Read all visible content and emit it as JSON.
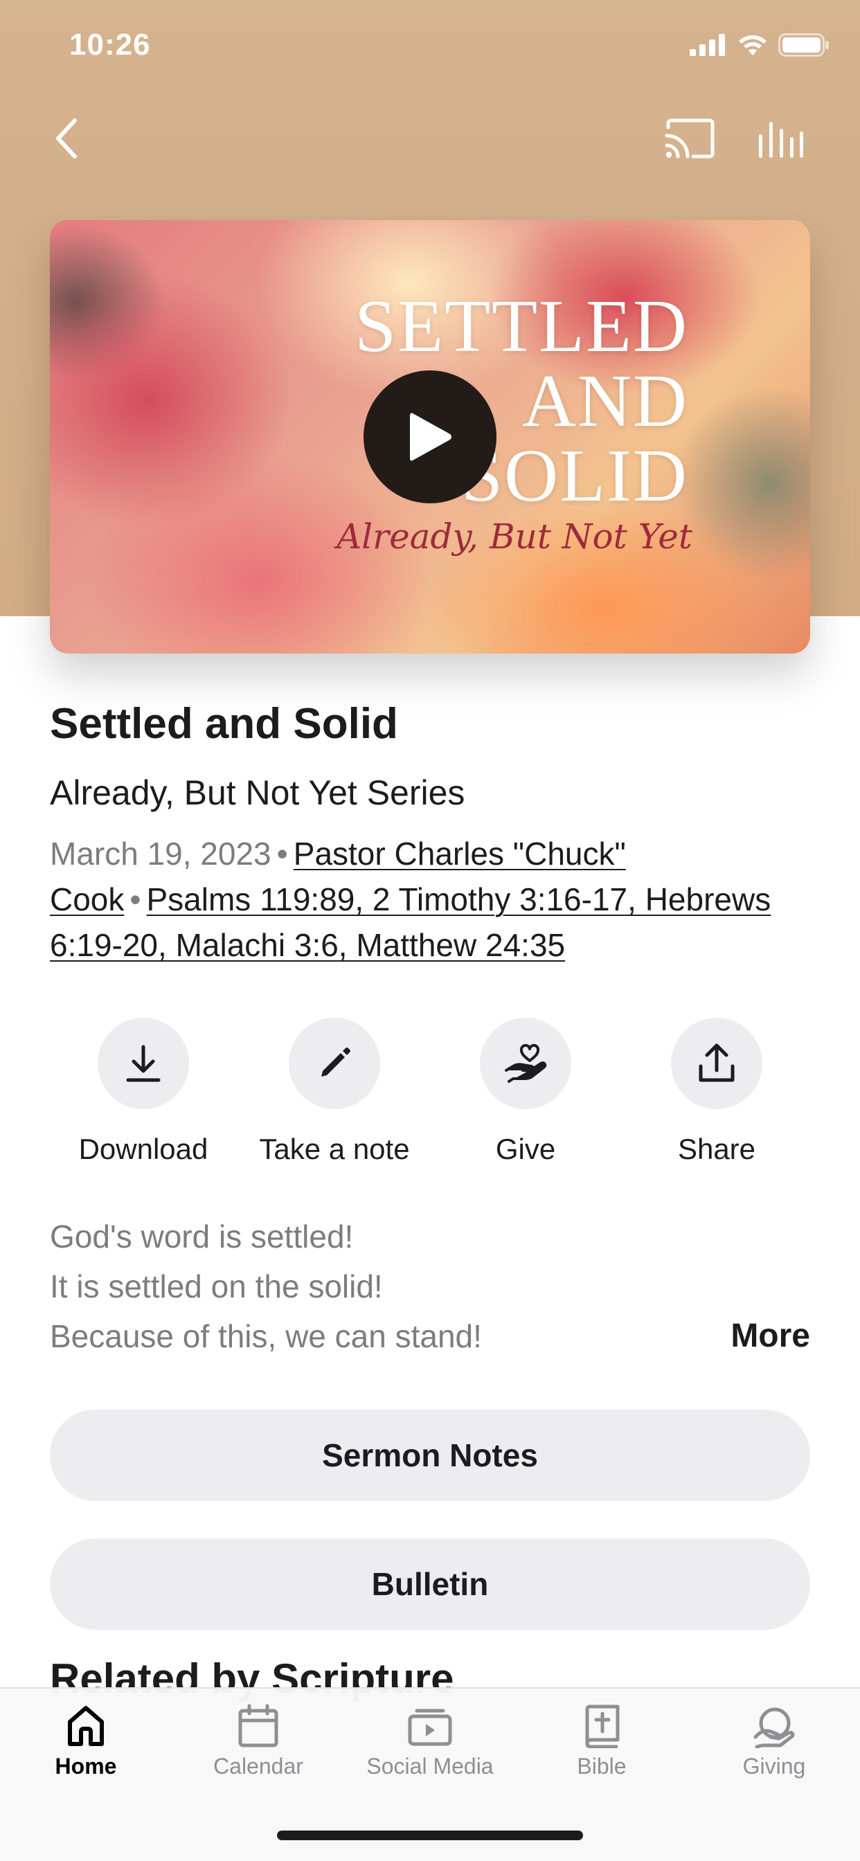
{
  "status_bar": {
    "time": "10:26"
  },
  "artwork": {
    "title_lines": [
      "SETTLED",
      "AND",
      "SOLID"
    ],
    "subtitle": "Already, But Not Yet"
  },
  "sermon": {
    "title": "Settled and Solid",
    "series": "Already, But Not Yet Series",
    "date": "March 19, 2023",
    "separator": "•",
    "speaker": "Pastor Charles \"Chuck\" Cook",
    "scripture": "Psalms 119:89, 2 Timothy 3:16-17, Hebrews 6:19-20, Malachi 3:6, Matthew 24:35"
  },
  "actions": [
    {
      "label": "Download",
      "icon": "download-icon"
    },
    {
      "label": "Take a note",
      "icon": "pencil-icon"
    },
    {
      "label": "Give",
      "icon": "heart-hand-icon"
    },
    {
      "label": "Share",
      "icon": "share-icon"
    }
  ],
  "description": {
    "lines": [
      "God's word is settled!",
      "It is settled on the solid!",
      "Because of this, we can stand!"
    ],
    "more_label": "More"
  },
  "buttons": {
    "sermon_notes": "Sermon Notes",
    "bulletin": "Bulletin"
  },
  "related_heading": "Related by Scripture",
  "tab_bar": {
    "active": "Home",
    "tabs": [
      {
        "label": "Home",
        "icon": "home-icon"
      },
      {
        "label": "Calendar",
        "icon": "calendar-icon"
      },
      {
        "label": "Social Media",
        "icon": "video-icon"
      },
      {
        "label": "Bible",
        "icon": "bible-icon"
      },
      {
        "label": "Giving",
        "icon": "giving-icon"
      }
    ]
  },
  "colors": {
    "header": "#d3b08a",
    "pill_bg": "#ededef",
    "secondary_text": "#7c7c80"
  }
}
